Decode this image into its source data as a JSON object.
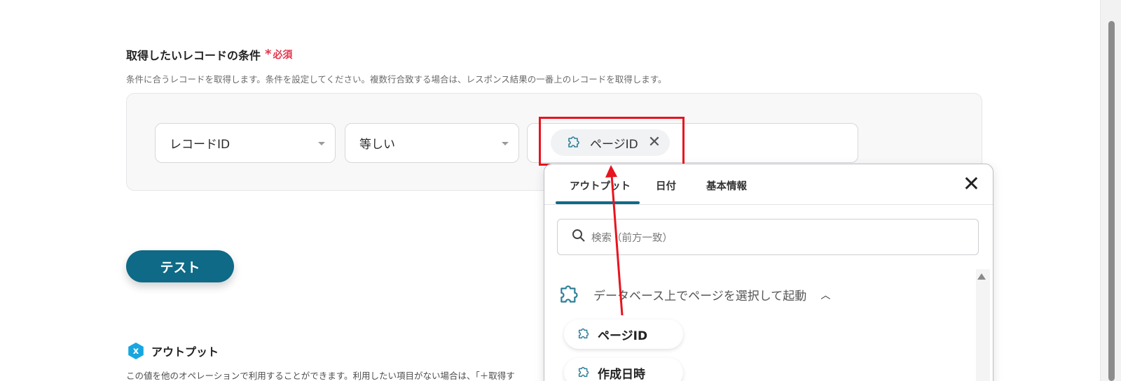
{
  "condition_section": {
    "title": "取得したいレコードの条件",
    "required_label": "必須",
    "description": "条件に合うレコードを取得します。条件を設定してください。複数行合致する場合は、レスポンス結果の一番上のレコードを取得します。",
    "field_select": "レコードID",
    "operator_select": "等しい",
    "value_chip": "ページID"
  },
  "test_button": "テスト",
  "output_section": {
    "title": "アウトプット",
    "icon_letter": "x",
    "description": "この値を他のオペレーションで利用することができます。利用したい項目がない場合は、「＋取得す"
  },
  "dropdown": {
    "tabs": [
      "アウトプット",
      "日付",
      "基本情報"
    ],
    "active_tab": "アウトプット",
    "search_placeholder": "検索（前方一致）",
    "group_title": "データベース上でページを選択して起動",
    "items": [
      "ページID",
      "作成日時"
    ]
  },
  "colors": {
    "accent": "#0e6a86",
    "required": "#e5344a",
    "highlight": "#e8141e",
    "output_icon": "#17a7e0"
  },
  "icons": {
    "chip_icon": "puzzle-icon",
    "clear": "close-icon",
    "search": "search-icon",
    "collapse": "chevron-up-icon"
  }
}
